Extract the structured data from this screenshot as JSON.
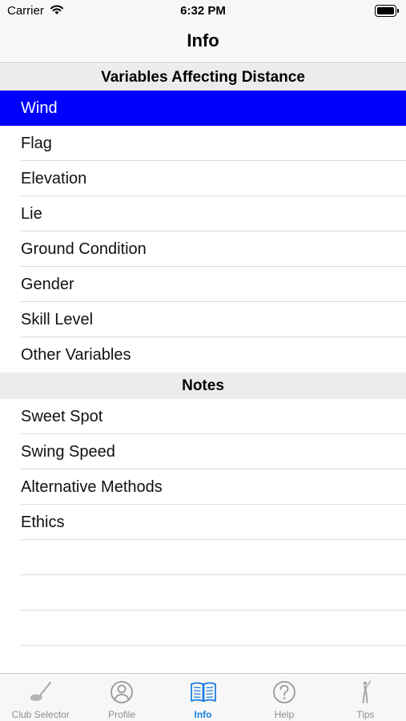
{
  "status_bar": {
    "carrier": "Carrier",
    "time": "6:32 PM"
  },
  "nav": {
    "title": "Info"
  },
  "sections": [
    {
      "header": "Variables Affecting Distance",
      "items": [
        "Wind",
        "Flag",
        "Elevation",
        "Lie",
        "Ground Condition",
        "Gender",
        "Skill Level",
        "Other Variables"
      ],
      "selected_index": 0
    },
    {
      "header": "Notes",
      "items": [
        "Sweet Spot",
        "Swing Speed",
        "Alternative Methods",
        "Ethics"
      ]
    }
  ],
  "tab_bar": {
    "active": "Info",
    "tabs": [
      {
        "label": "Club Selector",
        "icon": "golf-club-icon"
      },
      {
        "label": "Profile",
        "icon": "person-circle-icon"
      },
      {
        "label": "Info",
        "icon": "book-icon"
      },
      {
        "label": "Help",
        "icon": "question-circle-icon"
      },
      {
        "label": "Tips",
        "icon": "golfer-icon"
      }
    ]
  },
  "colors": {
    "selected_row": "#0000ff",
    "tab_active": "#1a7fe0",
    "tab_inactive": "#8e8e8e"
  }
}
